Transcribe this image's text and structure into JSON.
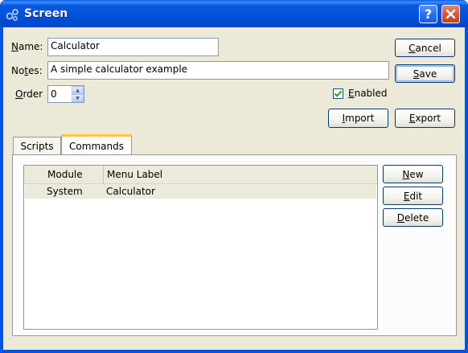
{
  "window": {
    "title": "Screen",
    "help_label": "?"
  },
  "form": {
    "name_label_ul": "N",
    "name_label_rest": "ame:",
    "name_value": "Calculator",
    "notes_label_pre": "No",
    "notes_label_ul": "t",
    "notes_label_rest": "es:",
    "notes_value": "A simple calculator example",
    "order_label_ul": "O",
    "order_label_rest": "rder",
    "order_value": "0",
    "enabled_label_ul": "E",
    "enabled_label_rest": "nabled",
    "enabled_checked": true
  },
  "buttons": {
    "cancel_ul": "C",
    "cancel_rest": "ancel",
    "save_ul": "S",
    "save_rest": "ave",
    "import_ul": "I",
    "import_rest": "mport",
    "export_ul": "E",
    "export_rest": "xport"
  },
  "tabs": [
    {
      "label": "Scripts"
    },
    {
      "label": "Commands"
    }
  ],
  "commands": {
    "columns": [
      "Module",
      "Menu Label"
    ],
    "rows": [
      {
        "module": "System",
        "menu_label": "Calculator"
      }
    ],
    "new_ul": "N",
    "new_rest": "ew",
    "edit_ul": "E",
    "edit_rest": "dit",
    "delete_ul": "D",
    "delete_rest": "elete"
  }
}
